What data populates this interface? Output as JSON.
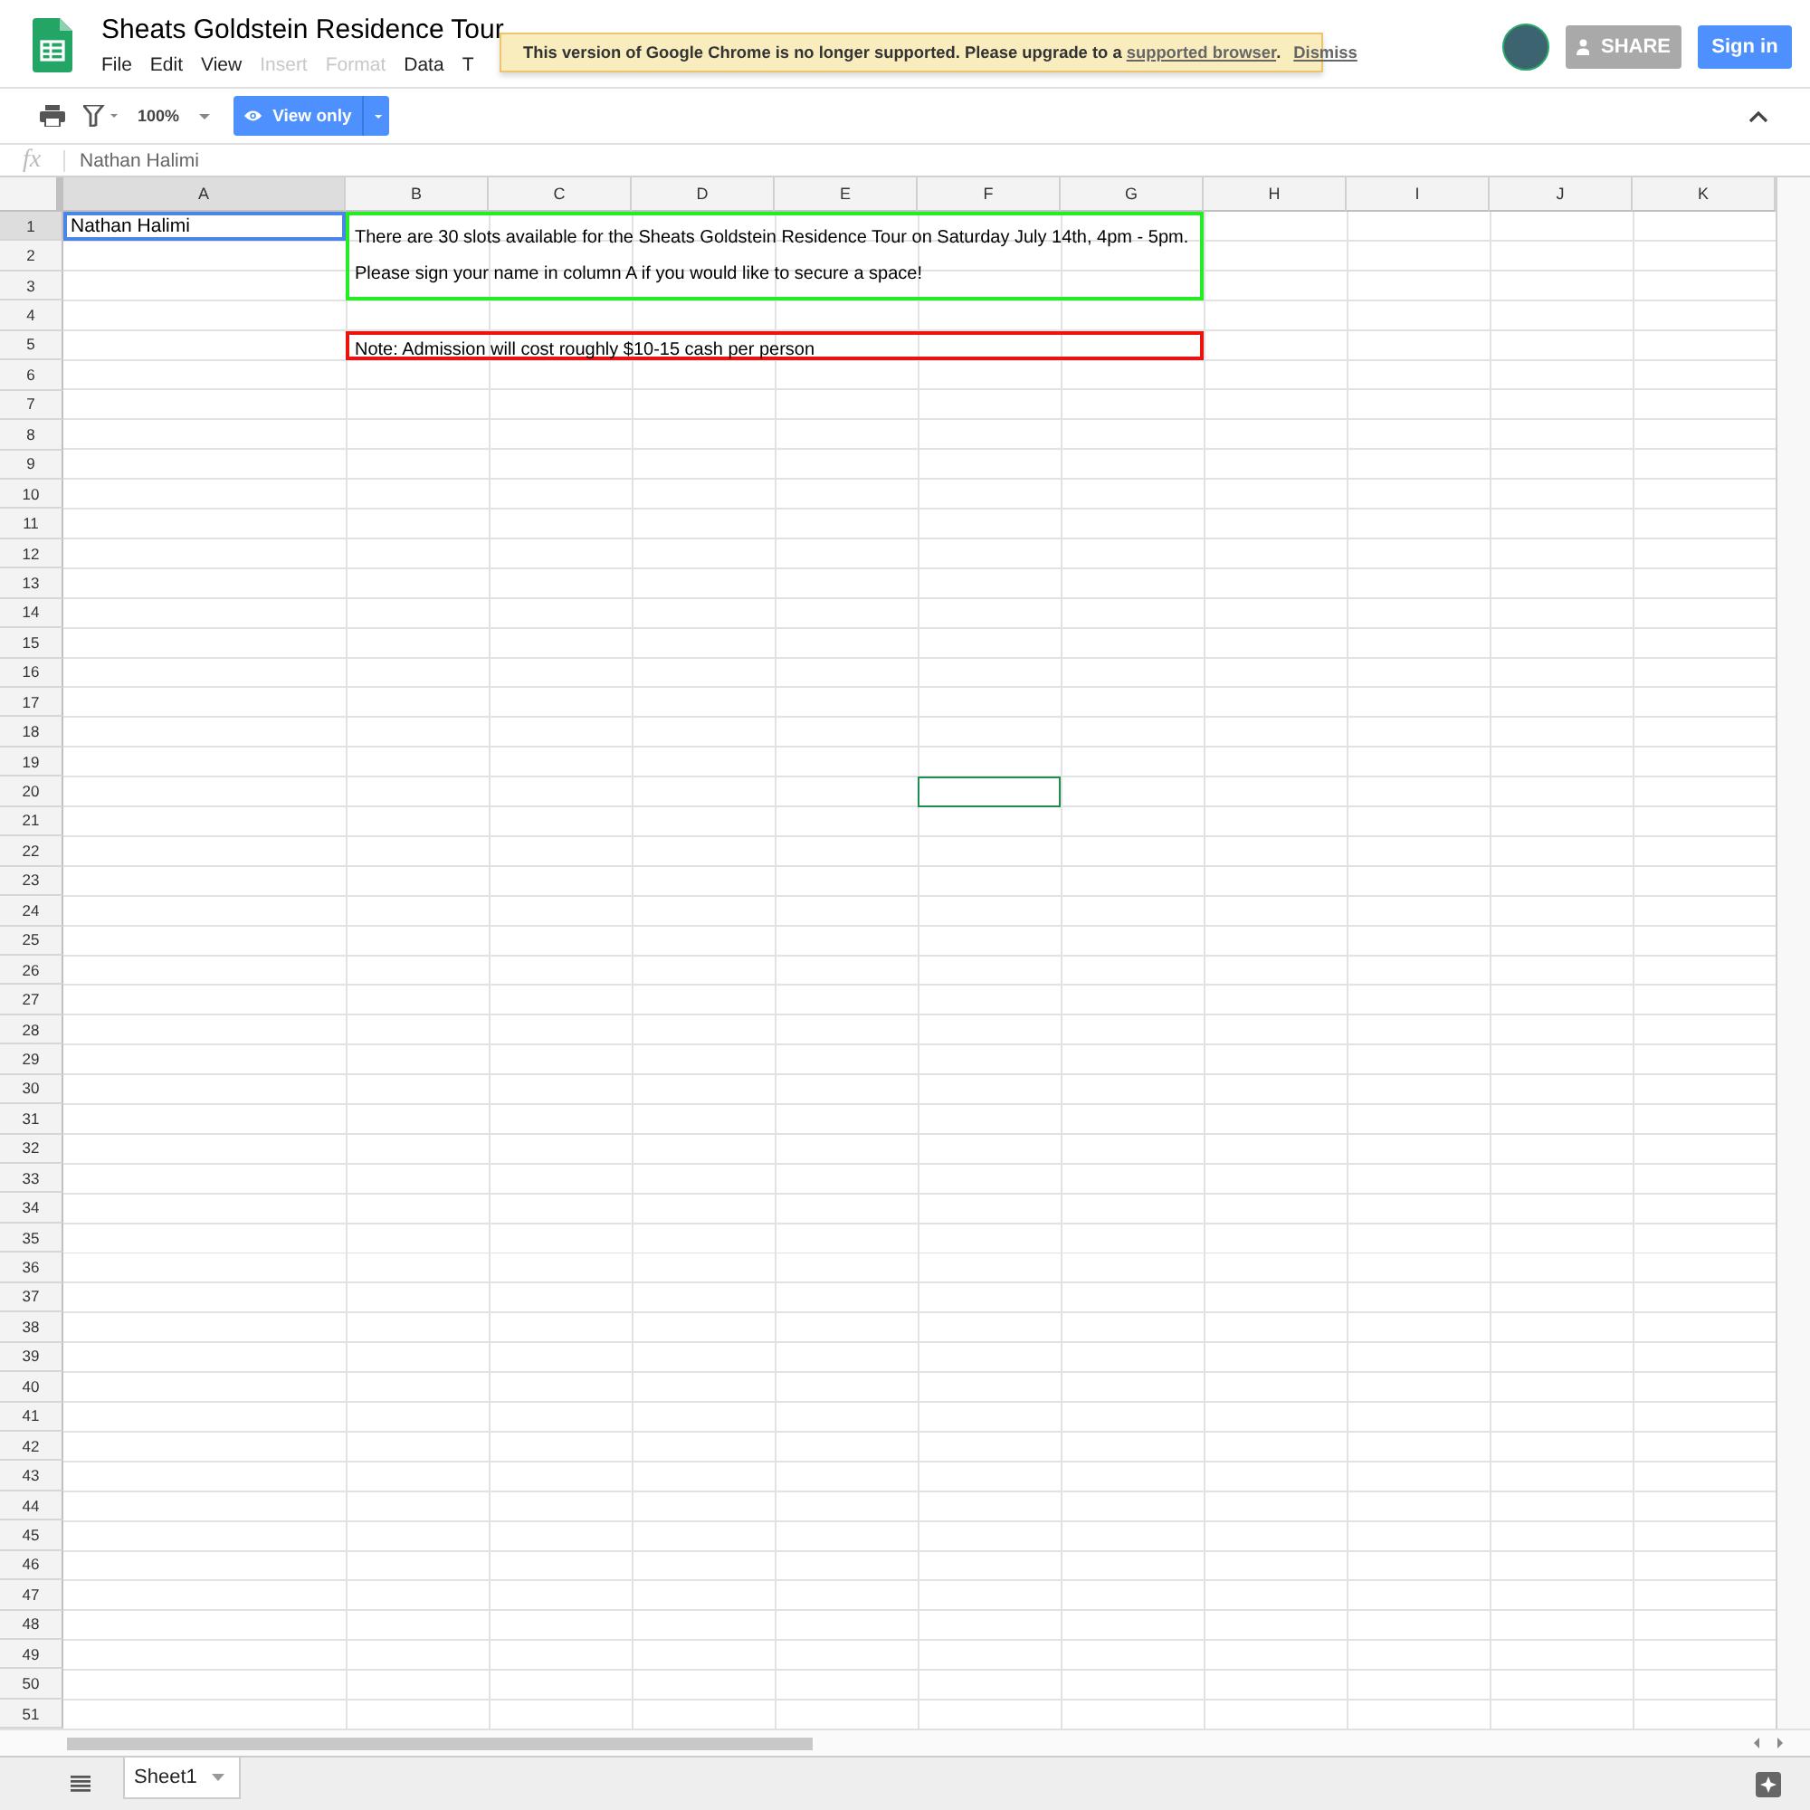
{
  "document": {
    "title": "Sheats Goldstein Residence Tour"
  },
  "menus": [
    {
      "label": "File",
      "disabled": false
    },
    {
      "label": "Edit",
      "disabled": false
    },
    {
      "label": "View",
      "disabled": false
    },
    {
      "label": "Insert",
      "disabled": true
    },
    {
      "label": "Format",
      "disabled": true
    },
    {
      "label": "Data",
      "disabled": false
    },
    {
      "label": "T",
      "disabled": false
    }
  ],
  "banner": {
    "message": "This version of Google Chrome is no longer supported. Please upgrade to a ",
    "link": "supported browser",
    "end": ".",
    "dismiss": "Dismiss"
  },
  "header_buttons": {
    "share": {
      "label": "SHARE",
      "disabled": true
    },
    "sign_in": "Sign in"
  },
  "toolbar": {
    "zoom": "100%",
    "mode": "View only"
  },
  "formula_bar": {
    "label": "fx",
    "value": "Nathan Halimi"
  },
  "columns": [
    {
      "label": "A",
      "selected": true
    },
    {
      "label": "B",
      "selected": false
    },
    {
      "label": "C",
      "selected": false
    },
    {
      "label": "D",
      "selected": false
    },
    {
      "label": "E",
      "selected": false
    },
    {
      "label": "F",
      "selected": false
    },
    {
      "label": "G",
      "selected": false
    },
    {
      "label": "H",
      "selected": false
    },
    {
      "label": "I",
      "selected": false
    },
    {
      "label": "J",
      "selected": false
    },
    {
      "label": "K",
      "selected": false
    }
  ],
  "rows": [
    {
      "label": "1",
      "selected": true
    },
    {
      "label": "2",
      "selected": false
    },
    {
      "label": "3",
      "selected": false
    },
    {
      "label": "4",
      "selected": false
    },
    {
      "label": "5",
      "selected": false
    },
    {
      "label": "6",
      "selected": false
    },
    {
      "label": "7",
      "selected": false
    },
    {
      "label": "8",
      "selected": false
    },
    {
      "label": "9",
      "selected": false
    },
    {
      "label": "10",
      "selected": false
    },
    {
      "label": "11",
      "selected": false
    },
    {
      "label": "12",
      "selected": false
    },
    {
      "label": "13",
      "selected": false
    },
    {
      "label": "14",
      "selected": false
    },
    {
      "label": "15",
      "selected": false
    },
    {
      "label": "16",
      "selected": false
    },
    {
      "label": "17",
      "selected": false
    },
    {
      "label": "18",
      "selected": false
    },
    {
      "label": "19",
      "selected": false
    },
    {
      "label": "20",
      "selected": false
    },
    {
      "label": "21",
      "selected": false
    },
    {
      "label": "22",
      "selected": false
    },
    {
      "label": "23",
      "selected": false
    },
    {
      "label": "24",
      "selected": false
    },
    {
      "label": "25",
      "selected": false
    },
    {
      "label": "26",
      "selected": false
    },
    {
      "label": "27",
      "selected": false
    },
    {
      "label": "28",
      "selected": false
    },
    {
      "label": "29",
      "selected": false
    },
    {
      "label": "30",
      "selected": false
    },
    {
      "label": "31",
      "selected": false
    },
    {
      "label": "32",
      "selected": false
    },
    {
      "label": "33",
      "selected": false
    },
    {
      "label": "34",
      "selected": false
    },
    {
      "label": "35",
      "selected": false
    },
    {
      "label": "36",
      "selected": false
    },
    {
      "label": "37",
      "selected": false
    },
    {
      "label": "38",
      "selected": false
    },
    {
      "label": "39",
      "selected": false
    },
    {
      "label": "40",
      "selected": false
    },
    {
      "label": "41",
      "selected": false
    },
    {
      "label": "42",
      "selected": false
    },
    {
      "label": "43",
      "selected": false
    },
    {
      "label": "44",
      "selected": false
    },
    {
      "label": "45",
      "selected": false
    },
    {
      "label": "46",
      "selected": false
    },
    {
      "label": "47",
      "selected": false
    },
    {
      "label": "48",
      "selected": false
    },
    {
      "label": "49",
      "selected": false
    },
    {
      "label": "50",
      "selected": false
    },
    {
      "label": "51",
      "selected": false
    }
  ],
  "name_cell": {
    "text": "Nathan Halimi",
    "selected": true
  },
  "notes": [
    {
      "color": "#22ee22",
      "lines": [
        "There are 30 slots available for the Sheats Goldstein Residence Tour on Saturday July 14th, 4pm - 5pm.",
        "Please sign your name in column A if you would like to secure a space!"
      ]
    },
    {
      "color": "#ee1111",
      "lines": [
        "Note: Admission will cost roughly $10-15 cash per person"
      ]
    }
  ],
  "sheet_tabs": [
    {
      "label": "Sheet1",
      "selected": true
    }
  ]
}
